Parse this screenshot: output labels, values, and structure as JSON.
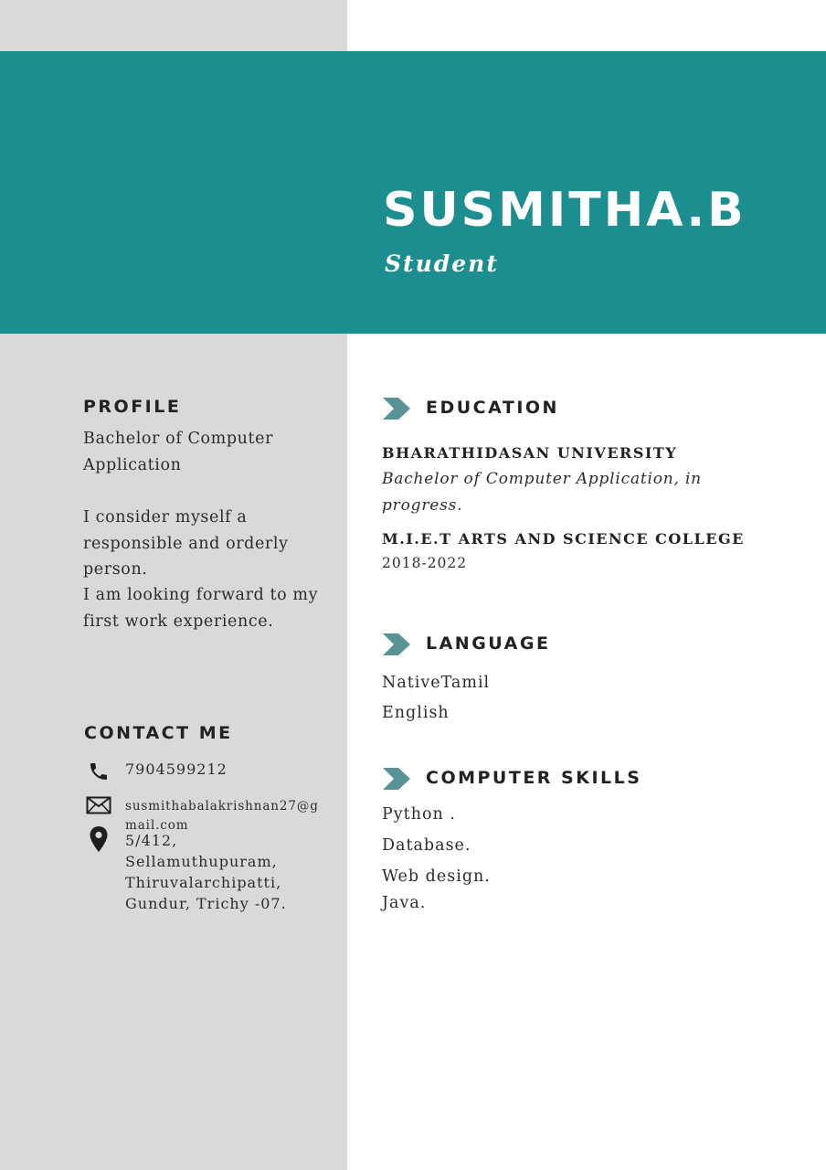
{
  "header": {
    "name": "SUSMITHA.B",
    "role": "Student"
  },
  "profile": {
    "heading": "PROFILE",
    "degree": "Bachelor of Computer Application",
    "paragraph1": "I consider myself a responsible and orderly person.",
    "paragraph2": "I am looking forward to my first work experience."
  },
  "contact": {
    "heading": "CONTACT ME",
    "phone": "7904599212",
    "email": "susmithabalakrishnan27@gmail.com",
    "address": "5/412, Sellamuthupuram, Thiruvalarchipatti, Gundur, Trichy -07.",
    "icons": [
      "phone-icon",
      "mail-icon",
      "location-pin-icon"
    ]
  },
  "education": {
    "heading": "EDUCATION",
    "entries": [
      {
        "school": "BHARATHIDASAN UNIVERSITY",
        "detail": "Bachelor of Computer Application, in progress."
      },
      {
        "school": "M.I.E.T  ARTS AND SCIENCE COLLEGE",
        "detail": "2018-2022"
      }
    ]
  },
  "language": {
    "heading": "LANGUAGE",
    "items": [
      "NativeTamil",
      "English"
    ]
  },
  "skills": {
    "heading": "COMPUTER SKILLS",
    "items": [
      "Python .",
      "Database.",
      "Web design.",
      "Java."
    ]
  },
  "colors": {
    "accent": "#1d8e8f",
    "side_panel": "#d9d9d9",
    "chevron": "#5a9396"
  }
}
